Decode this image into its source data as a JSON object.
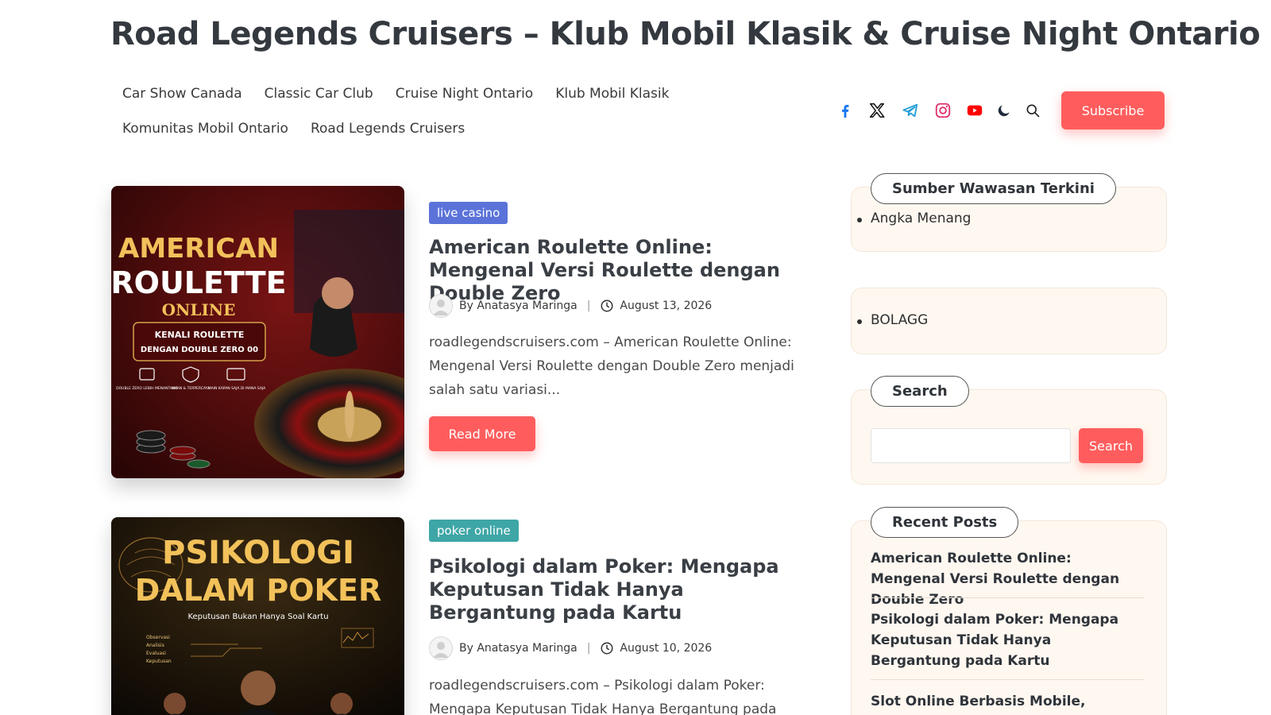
{
  "site": {
    "title": "Road Legends Cruisers – Klub Mobil Klasik & Cruise Night Ontario"
  },
  "nav": {
    "row1": [
      "Car Show Canada",
      "Classic Car Club",
      "Cruise Night Ontario",
      "Klub Mobil Klasik"
    ],
    "row2": [
      "Komunitas Mobil Ontario",
      "Road Legends Cruisers"
    ]
  },
  "header": {
    "icons": [
      "facebook-icon",
      "x-twitter-icon",
      "telegram-icon",
      "instagram-icon",
      "youtube-icon",
      "dark-mode-moon-icon",
      "search-icon"
    ],
    "subscribe_label": "Subscribe"
  },
  "colors": {
    "accent": "#ff5d5d",
    "badge_live_casino": "#5b73d9",
    "badge_poker_online": "#3ea6a6",
    "widget_bg": "#fff8f1"
  },
  "posts": [
    {
      "category": "live casino",
      "title": "American Roulette Online: Mengenal Versi Roulette dengan Double Zero",
      "author": "By Anatasya Maringa",
      "date": "August 13, 2026",
      "excerpt": "roadlegendscruisers.com – American Roulette Online: Mengenal Versi Roulette dengan Double Zero menjadi salah satu variasi...",
      "read_more": "Read More",
      "image_text": {
        "line1": "AMERICAN",
        "line2": "ROULETTE",
        "line3": "ONLINE",
        "line4": "KENALI ROULETTE",
        "line5": "DENGAN DOUBLE ZERO 00",
        "feat1": "DOUBLE ZERO LEBIH MENANTANG",
        "feat2": "AMAN & TERPERCAYA",
        "feat3": "MAIN KAPAN SAJA DI MANA SAJA"
      }
    },
    {
      "category": "poker online",
      "title": "Psikologi dalam Poker: Mengapa Keputusan Tidak Hanya Bergantung pada Kartu",
      "author": "By Anatasya Maringa",
      "date": "August 10, 2026",
      "excerpt": "roadlegendscruisers.com – Psikologi dalam Poker: Mengapa Keputusan Tidak Hanya Bergantung pada",
      "image_text": {
        "line1": "PSIKOLOGI",
        "line2": "DALAM POKER",
        "line3": "Keputusan Bukan Hanya Soal Kartu",
        "l1": "Observasi",
        "l2": "Analisis",
        "l3": "Evaluasi",
        "l4": "Keputusan"
      }
    }
  ],
  "sidebar": {
    "insights": {
      "title": "Sumber Wawasan Terkini",
      "items": [
        "Angka Menang"
      ]
    },
    "links": {
      "items": [
        "BOLAGG"
      ]
    },
    "search": {
      "title": "Search",
      "placeholder": "",
      "button": "Search"
    },
    "recent": {
      "title": "Recent Posts",
      "items": [
        "American Roulette Online: Mengenal Versi Roulette dengan Double Zero",
        "Psikologi dalam Poker: Mengapa Keputusan Tidak Hanya Bergantung pada Kartu",
        "Slot Online Berbasis Mobile, Semakin Praktis untuk Dimainkan"
      ]
    }
  }
}
